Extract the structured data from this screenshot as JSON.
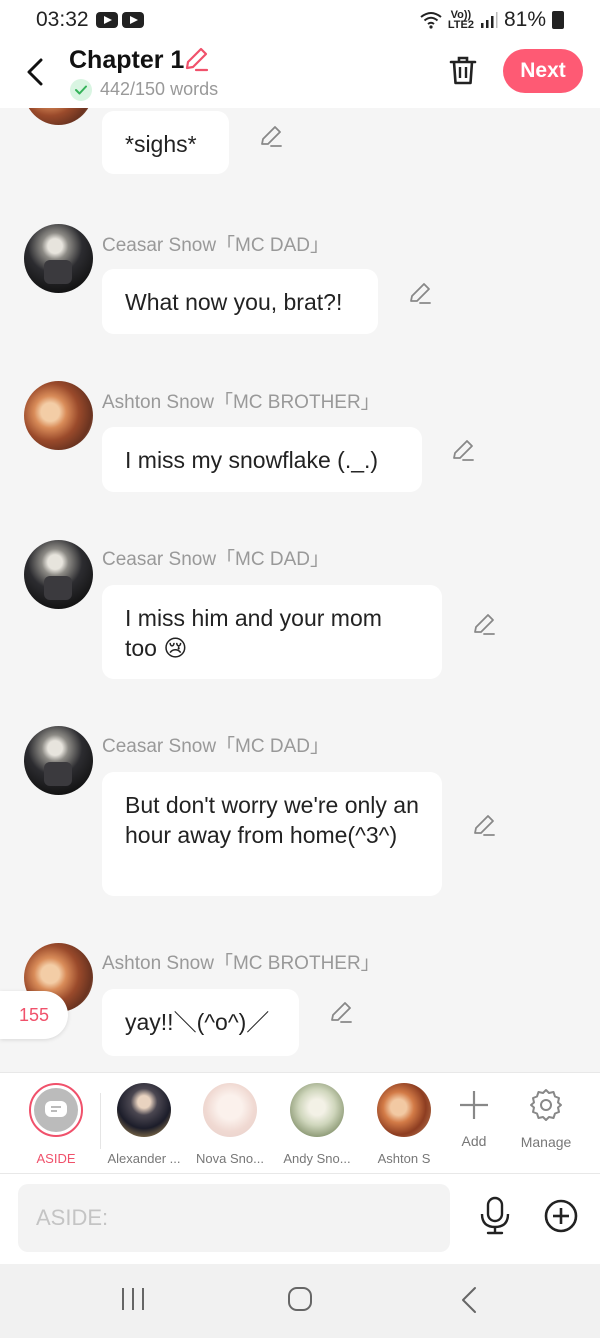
{
  "status_bar": {
    "time": "03:32",
    "network_top": "Vo))",
    "network_bottom": "LTE2",
    "battery": "81%"
  },
  "header": {
    "title": "Chapter 1",
    "word_count": "442/150 words",
    "next_label": "Next",
    "accent_color": "#fe5a74"
  },
  "messages": [
    {
      "speaker": "",
      "text": "*sighs*",
      "avatar": "ashton"
    },
    {
      "speaker": "Ceasar Snow「MC DAD」",
      "text": "What now you, brat?!",
      "avatar": "ceasar"
    },
    {
      "speaker": "Ashton Snow「MC BROTHER」",
      "text": "I miss my snowflake (._.)",
      "avatar": "ashton"
    },
    {
      "speaker": "Ceasar Snow「MC DAD」",
      "text": "I miss him and your mom too 😢",
      "avatar": "ceasar"
    },
    {
      "speaker": "Ceasar Snow「MC DAD」",
      "text": "But don't worry we're only an hour away from home(^3^)",
      "avatar": "ceasar"
    },
    {
      "speaker": "Ashton Snow「MC BROTHER」",
      "text": "yay!!＼(^o^)／",
      "avatar": "ashton"
    }
  ],
  "message_count": "155",
  "characters": {
    "aside": "ASIDE",
    "items": [
      "Alexander ...",
      "Nova Sno...",
      "Andy Sno...",
      "Ashton S"
    ],
    "add_label": "Add",
    "manage_label": "Manage"
  },
  "input": {
    "placeholder": "ASIDE:"
  }
}
